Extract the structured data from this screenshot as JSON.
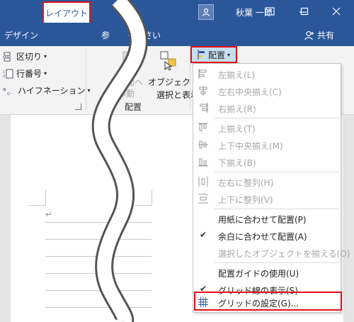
{
  "titlebar": {
    "user_name": "秋葉 一郎",
    "icons": [
      "user-icon",
      "ribbon-display-icon",
      "minimize-icon",
      "maximize-icon",
      "close-icon"
    ]
  },
  "tabs": {
    "design": "デザイン",
    "layout": "レイアウト",
    "tell_me_prefix": "参",
    "tell_me_suffix": "ください",
    "share": "共有"
  },
  "ribbon": {
    "breaks": "区切り",
    "line_numbers": "行番号",
    "hyphenation": "ハイフネーション",
    "send_backward_1": "背面へ",
    "send_backward_2": "移動",
    "selection_pane_1": "オブジェクトの",
    "selection_pane_2": "選択と表示",
    "arrange_group": "配置",
    "align_button": "配置"
  },
  "menu": {
    "items": [
      {
        "label": "左揃え(L)",
        "enabled": false,
        "icon": "align-left-icon"
      },
      {
        "label": "左右中央揃え(C)",
        "enabled": false,
        "icon": "align-center-icon"
      },
      {
        "label": "右揃え(R)",
        "enabled": false,
        "icon": "align-right-icon"
      },
      {
        "label": "上揃え(T)",
        "enabled": false,
        "icon": "align-top-icon"
      },
      {
        "label": "上下中央揃え(M)",
        "enabled": false,
        "icon": "align-middle-icon"
      },
      {
        "label": "下揃え(B)",
        "enabled": false,
        "icon": "align-bottom-icon"
      },
      {
        "label": "左右に整列(H)",
        "enabled": false,
        "icon": "distribute-horizontal-icon"
      },
      {
        "label": "上下に整列(V)",
        "enabled": false,
        "icon": "distribute-vertical-icon"
      },
      {
        "label": "用紙に合わせて配置(P)",
        "enabled": true,
        "checked": false
      },
      {
        "label": "余白に合わせて配置(A)",
        "enabled": true,
        "checked": true
      },
      {
        "label": "選択したオブジェクトを揃える(O)",
        "enabled": false,
        "checked": false
      },
      {
        "label": "配置ガイドの使用(U)",
        "enabled": true,
        "checked": false
      },
      {
        "label": "グリッド線の表示(S)",
        "enabled": true,
        "checked": true
      },
      {
        "label": "グリッドの設定(G)...",
        "enabled": true,
        "icon": "grid-icon",
        "highlighted": true
      }
    ]
  },
  "colors": {
    "accent": "#2b579a",
    "highlight_border": "#e0101a",
    "selected_button": "#c5ddf3"
  }
}
